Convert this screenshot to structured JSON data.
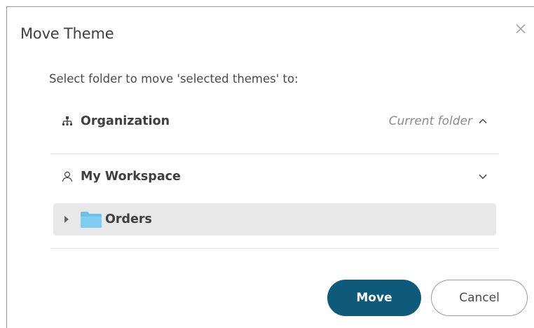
{
  "dialog": {
    "title": "Move Theme",
    "prompt": "Select folder to move 'selected themes' to:",
    "close_icon": "close-icon"
  },
  "folders": {
    "organization": {
      "icon": "org-hierarchy-icon",
      "label": "Organization",
      "status": "Current folder",
      "chevron": "chevron-up-icon"
    },
    "workspace": {
      "icon": "user-icon",
      "label": "My Workspace",
      "chevron": "chevron-down-icon",
      "items": [
        {
          "label": "Orders",
          "icon": "folder-icon",
          "caret": "caret-right-icon"
        }
      ]
    }
  },
  "actions": {
    "move_label": "Move",
    "cancel_label": "Cancel"
  },
  "colors": {
    "primary": "#0e5a7a",
    "folder": "#6ac2e8",
    "selected_row": "#e8e8e8"
  }
}
